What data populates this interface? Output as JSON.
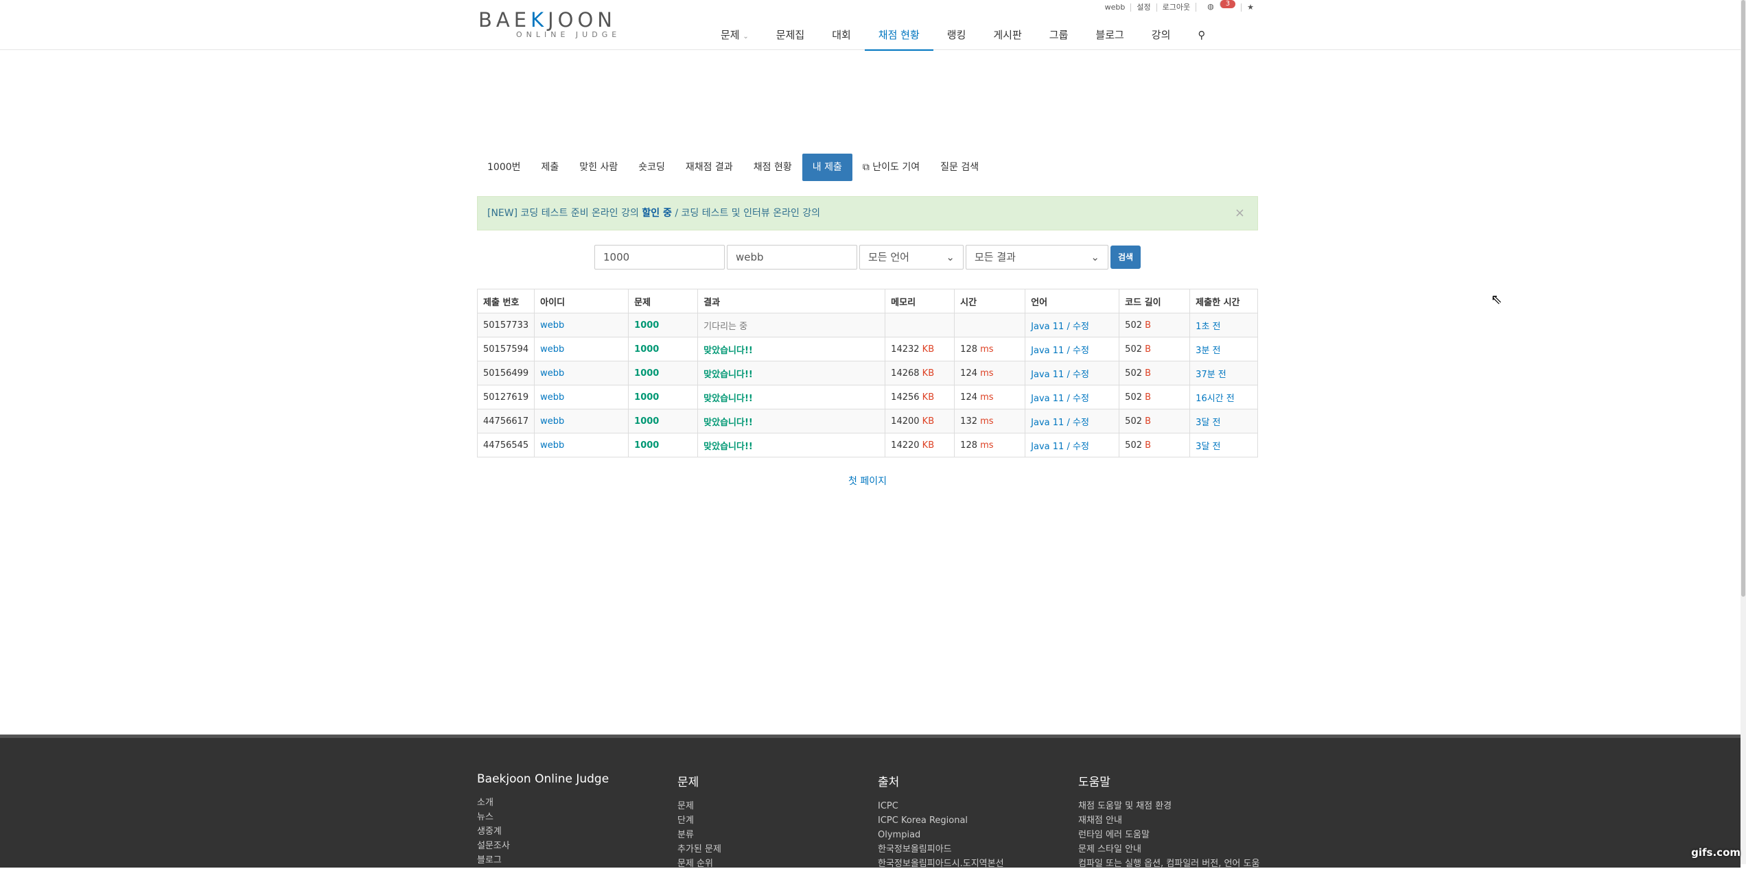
{
  "utility": {
    "user": "webb",
    "settings": "설정",
    "logout": "로그아웃",
    "notif_count": "3"
  },
  "logo": {
    "main_left": "BAE",
    "main_k": "K",
    "main_right": "JOON",
    "sub": "ONLINE JUDGE"
  },
  "nav": [
    "문제",
    "문제집",
    "대회",
    "채점 현황",
    "랭킹",
    "게시판",
    "그룹",
    "블로그",
    "강의"
  ],
  "tabs": [
    "1000번",
    "제출",
    "맞힌 사람",
    "숏코딩",
    "재채점 결과",
    "채점 현황",
    "내 제출",
    "난이도 기여",
    "질문 검색"
  ],
  "alert": {
    "new": "[NEW] 코딩 테스트 준비 온라인 강의 ",
    "discount": "할인 중",
    "rest": " / 코딩 테스트 및 인터뷰 온라인 강의"
  },
  "search": {
    "problem": "1000",
    "user": "webb",
    "lang": "모든 언어",
    "result": "모든 결과",
    "button": "검색"
  },
  "table": {
    "headers": [
      "제출 번호",
      "아이디",
      "문제",
      "결과",
      "메모리",
      "시간",
      "언어",
      "코드 길이",
      "제출한 시간"
    ],
    "rows": [
      {
        "id": "50157733",
        "user": "webb",
        "prob": "1000",
        "result": "기다리는 중",
        "mem": "",
        "time": "",
        "lang": "Java 11",
        "edit": "수정",
        "len": "502",
        "when": "1초 전"
      },
      {
        "id": "50157594",
        "user": "webb",
        "prob": "1000",
        "result": "맞았습니다!!",
        "mem": "14232",
        "time": "128",
        "lang": "Java 11",
        "edit": "수정",
        "len": "502",
        "when": "3분 전"
      },
      {
        "id": "50156499",
        "user": "webb",
        "prob": "1000",
        "result": "맞았습니다!!",
        "mem": "14268",
        "time": "124",
        "lang": "Java 11",
        "edit": "수정",
        "len": "502",
        "when": "37분 전"
      },
      {
        "id": "50127619",
        "user": "webb",
        "prob": "1000",
        "result": "맞았습니다!!",
        "mem": "14256",
        "time": "124",
        "lang": "Java 11",
        "edit": "수정",
        "len": "502",
        "when": "16시간 전"
      },
      {
        "id": "44756617",
        "user": "webb",
        "prob": "1000",
        "result": "맞았습니다!!",
        "mem": "14200",
        "time": "132",
        "lang": "Java 11",
        "edit": "수정",
        "len": "502",
        "when": "3달 전"
      },
      {
        "id": "44756545",
        "user": "webb",
        "prob": "1000",
        "result": "맞았습니다!!",
        "mem": "14220",
        "time": "128",
        "lang": "Java 11",
        "edit": "수정",
        "len": "502",
        "when": "3달 전"
      }
    ],
    "units": {
      "kb": "KB",
      "ms": "ms",
      "b": "B"
    }
  },
  "pagination": {
    "first": "첫 페이지"
  },
  "footer": [
    {
      "title": "Baekjoon Online Judge",
      "items": [
        "소개",
        "뉴스",
        "생중계",
        "설문조사",
        "블로그"
      ]
    },
    {
      "title": "문제",
      "items": [
        "문제",
        "단계",
        "분류",
        "추가된 문제",
        "문제 순위"
      ]
    },
    {
      "title": "출처",
      "items": [
        "ICPC",
        "ICPC Korea Regional",
        "Olympiad",
        "한국정보올림피아드",
        "한국정보올림피아드시.도지역본선"
      ]
    },
    {
      "title": "도움말",
      "items": [
        "채점 도움말 및 채점 환경",
        "재채점 안내",
        "런타임 에러 도움말",
        "문제 스타일 안내",
        "컴파일 또는 실행 옵션, 컴파일러 버전, 언어 도움"
      ]
    }
  ],
  "watermark": "gifs.com"
}
